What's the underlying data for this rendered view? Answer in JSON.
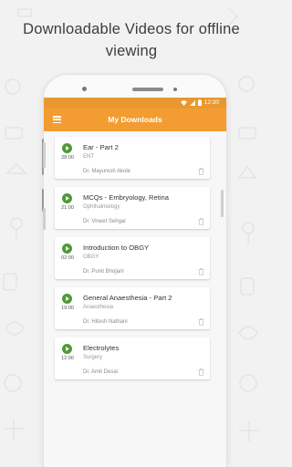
{
  "headline": {
    "line1": "Downloadable Videos for offline",
    "line2": "viewing"
  },
  "status_bar": {
    "time": "12:30",
    "icons": [
      "wifi-icon",
      "signal-icon",
      "battery-icon"
    ]
  },
  "app_bar": {
    "menu_icon": "hamburger-menu-icon",
    "title": "My Downloads"
  },
  "downloads": [
    {
      "title": "Ear - Part 2",
      "subject": "ENT",
      "duration": "28:00",
      "doctor": "Dr. Mayuresh Akole"
    },
    {
      "title": "MCQs - Embryology, Retina",
      "subject": "Ophthalmology",
      "duration": "21:00",
      "doctor": "Dr. Vineet Sehgal"
    },
    {
      "title": "Introduction to OBGY",
      "subject": "OBGY",
      "duration": "02:00",
      "doctor": "Dr. Punit Bhojani"
    },
    {
      "title": "General Anaesthesia - Part 2",
      "subject": "Anaesthesia",
      "duration": "19:00",
      "doctor": "Dr. Hitesh Nathani"
    },
    {
      "title": "Electrolytes",
      "subject": "Surgery",
      "duration": "12:00",
      "doctor": "Dr. Amit Desai"
    }
  ],
  "colors": {
    "accent": "#f39c32",
    "status_bar": "#e8982f",
    "play_button": "#4f9a33",
    "background": "#f2f2f2"
  }
}
